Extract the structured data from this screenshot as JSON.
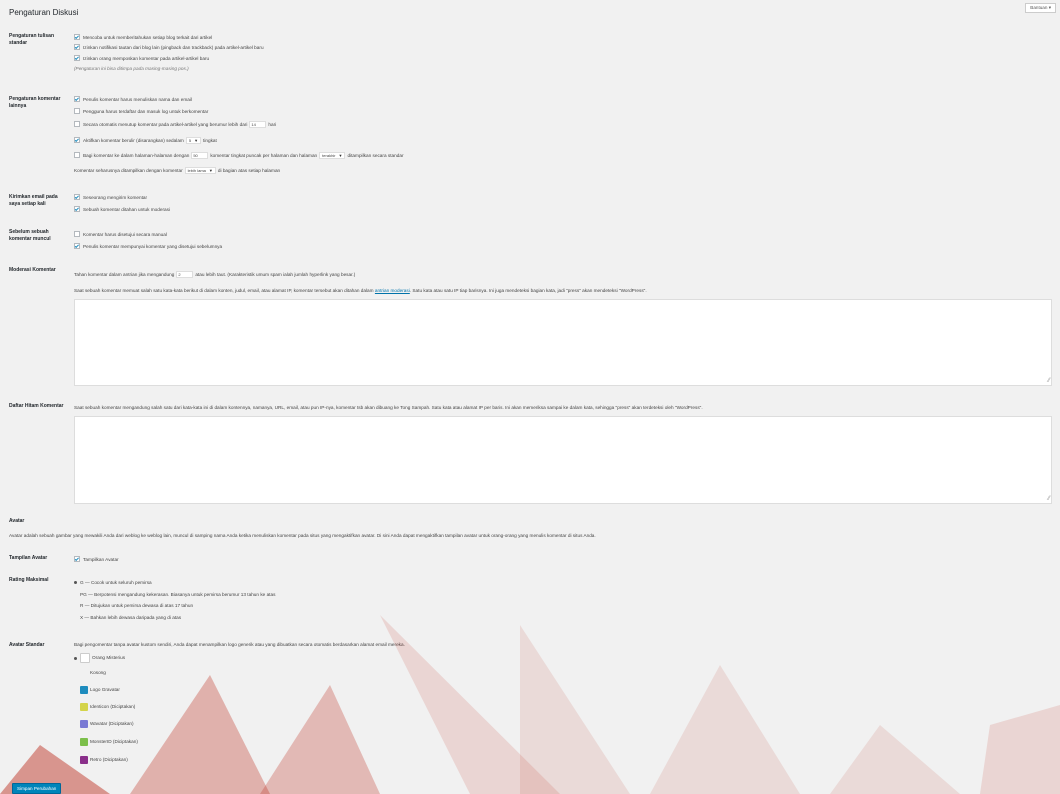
{
  "header": {
    "help_label": "Bantuan ▾",
    "title": "Pengaturan Diskusi"
  },
  "standard": {
    "label": "Pengaturan tulisan standar",
    "opt1": "Mencoba untuk memberitahukan setiap blog terkait dari artikel",
    "opt2": "Izinkan notifikasi tautan dari blog lain (pingback dan trackback) pada artikel-artikel baru",
    "opt3": "Izinkan orang memposkan komentar pada artikel-artikel baru",
    "note": "(Pengaturan ini bisa ditimpa pada masing-masing pos.)"
  },
  "other": {
    "label": "Pengaturan komentar lainnya",
    "opt1": "Penulis komentar harus menuliskan nama dan email",
    "opt2": "Pengguna harus terdaftar dan masuk log untuk berkomentar",
    "close_pre": "Secara otomatis menutup komentar pada artikel-artikel yang berumur lebih dari",
    "close_days": "14",
    "close_post": "hari",
    "thread_pre": "Aktifkan komentar berulir (disarangkan) sedalam",
    "thread_depth": "5",
    "thread_post": "tingkat",
    "page_pre": "Bagi komentar ke dalam halaman-halaman dengan",
    "page_count": "50",
    "page_mid": "komentar tingkat puncak per halaman dan halaman",
    "page_which": "terakhir",
    "page_post": "ditampilkan secara standar",
    "order_pre": "Komentar seharusnya ditampilkan dengan komentar",
    "order_which": "lebih lama",
    "order_post": "di bagian atas setiap halaman"
  },
  "email": {
    "label": "Kirimkan email pada saya setiap kali",
    "opt1": "Seseorang mengirim komentar",
    "opt2": "Sebuah komentar ditahan untuk moderasi"
  },
  "before": {
    "label": "Sebelum sebuah komentar muncul",
    "opt1": "Komentar harus disetujui secara manual",
    "opt2": "Penulis komentar mempunyai komentar yang disetujui sebelumnya"
  },
  "moderation": {
    "label": "Moderasi Komentar",
    "hold_pre": "Tahan komentar dalam antrian jika mengandung",
    "hold_count": "2",
    "hold_post": "atau lebih taut. (Karakteristik umum spam ialah jumlah hyperlink yang besar.)",
    "desc_pre": "Saat sebuah komentar memuat salah satu kata-kata berikut di dalam konten, judul, email, atau alamat IP, komentar tersebut akan ditahan dalam",
    "desc_link": "antrian moderasi",
    "desc_post": ". Satu kata atau satu IP tiap barisnya. Ini juga mendeteksi bagian kata, jadi \"press\" akan mendeteksi \"WordPress\"."
  },
  "blacklist": {
    "label": "Daftar Hitam Komentar",
    "desc": "Saat sebuah komentar mengandung salah satu dari kata-kata ini di dalam kontennya, namanya, URL, email, atau pun IP-nya, komentar tsb akan dibuang ke Tong Sampah. Satu kata atau alamat IP per baris. Ini akan memeriksa sampai ke dalam kata, sehingga \"press\" akan terdeteksi oleh \"WordPress\"."
  },
  "avatar": {
    "heading": "Avatar",
    "desc": "Avatar adalah sebuah gambar yang mewakili Anda dari weblog ke weblog lain, muncul di samping nama Anda ketika menuliskan komentar pada situs yang mengaktifkan avatar. Di sini Anda dapat mengaktifkan tampilan avatar untuk orang-orang yang menulis komentar di situs Anda.",
    "display_label": "Tampilan Avatar",
    "display_opt": "Tampilkan Avatar",
    "rating_label": "Rating Maksimal",
    "ratings": [
      "G — Cocok untuk seluruh pemirsa",
      "PG — Berpotensi mengandung kekerasan. Biasanya untuk pemirsa berumur 13 tahun ke atas",
      "R — Ditujukan untuk pemirsa dewasa di atas 17 tahun",
      "X — Bahkan lebih dewasa daripada yang di atas"
    ],
    "default_label": "Avatar Standar",
    "default_desc": "Bagi pengomentar tanpa avatar kustom sendiri, Anda dapat menampilkan logo generik atau yang dibuatkan secara otomatis berdasarkan alamat email mereka.",
    "defaults": [
      "Orang Misterius",
      "Kosong",
      "Logo Gravatar",
      "Identicon (Diciptakan)",
      "Wavatar (Diciptakan)",
      "MonsterID (Diciptakan)",
      "Retro (Diciptakan)"
    ]
  },
  "save_label": "Simpan Perubahan",
  "colors": {
    "accent": "#0085ba",
    "link": "#0073aa",
    "watermark": "#c0392b"
  }
}
